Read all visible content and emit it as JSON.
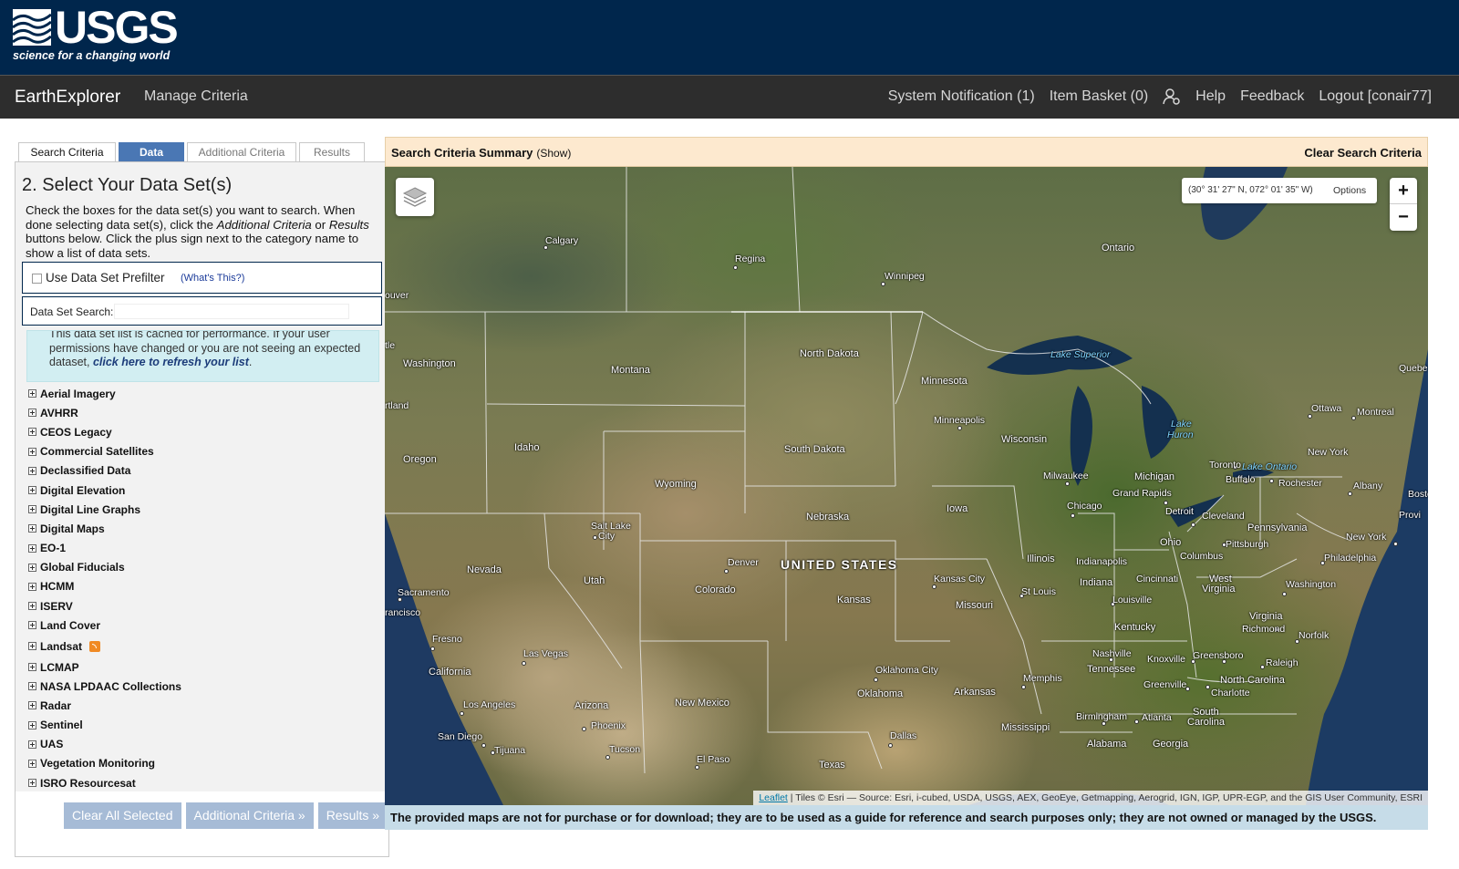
{
  "header": {
    "logo_text": "USGS",
    "logo_tagline": "science for a changing world"
  },
  "nav": {
    "app_title": "EarthExplorer",
    "manage_criteria": "Manage Criteria",
    "system_notification": "System Notification (1)",
    "item_basket": "Item Basket (0)",
    "user_icon": "user-settings-icon",
    "help": "Help",
    "feedback": "Feedback",
    "logout": "Logout [conair77]"
  },
  "tabs": [
    "Search Criteria",
    "Data Sets",
    "Additional Criteria",
    "Results"
  ],
  "active_tab": "Data Sets",
  "left_panel": {
    "title": "2. Select Your Data Set(s)",
    "instructions_1": "Check the boxes for the data set(s) you want to search. When done selecting data set(s), click the ",
    "instructions_addl": "Additional Criteria",
    "instructions_2": " or ",
    "instructions_results": "Results",
    "instructions_3": " buttons below. Click the plus sign next to the category name to show a list of data sets.",
    "prefilter_label": "Use Data Set Prefilter",
    "prefilter_help": "(What's This?)",
    "search_label": "Data Set Search:",
    "search_value": "",
    "notice_1": "This data set list is cached for performance. If your user permissions have changed or you are not seeing an expected dataset, ",
    "notice_link": "click here to refresh your list",
    "notice_2": ".",
    "categories": [
      "Aerial Imagery",
      "AVHRR",
      "CEOS Legacy",
      "Commercial Satellites",
      "Declassified Data",
      "Digital Elevation",
      "Digital Line Graphs",
      "Digital Maps",
      "EO-1",
      "Global Fiducials",
      "HCMM",
      "ISERV",
      "Land Cover",
      "Landsat",
      "LCMAP",
      "NASA LPDAAC Collections",
      "Radar",
      "Sentinel",
      "UAS",
      "Vegetation Monitoring",
      "ISRO Resourcesat"
    ],
    "buttons": {
      "clear": "Clear All Selected",
      "additional": "Additional Criteria »",
      "results": "Results »"
    }
  },
  "summary_bar": {
    "title": "Search Criteria Summary",
    "show": "(Show)",
    "clear": "Clear Search Criteria"
  },
  "map": {
    "coordinates": "(30° 31' 27\" N, 072° 01' 35\" W)",
    "options": "Options",
    "zoom_in": "+",
    "zoom_out": "−",
    "attribution_link": "Leaflet",
    "attribution_text": " | Tiles © Esri — Source: Esri, i-cubed, USDA, USGS, AEX, GeoEye, Getmapping, Aerogrid, IGN, IGP, UPR-EGP, and the GIS User Community, ESRI",
    "labels": {
      "calgary": "Calgary",
      "regina": "Regina",
      "winnipeg": "Winnipeg",
      "ontario": "Ontario",
      "quebec": "Quebe",
      "couver": "ouver",
      "tle": "tle",
      "washington": "Washington",
      "rtland": "rtland",
      "montana": "Montana",
      "north_dakota": "North Dakota",
      "lake_superior": "Lake Superior",
      "minnesota": "Minnesota",
      "ottawa": "Ottawa",
      "montreal": "Montreal",
      "minneapolis": "Minneapolis",
      "wisconsin": "Wisconsin",
      "lake_huron_1": "Lake",
      "lake_huron_2": "Huron",
      "oregon": "Oregon",
      "idaho": "Idaho",
      "south_dakota": "South Dakota",
      "toronto": "Toronto",
      "lake_ontario": "Lake Ontario",
      "new_york": "New York",
      "milwaukee": "Milwaukee",
      "michigan": "Michigan",
      "buffalo": "Buffalo",
      "rochester": "Rochester",
      "albany": "Albany",
      "bosto": "Bosto",
      "wyoming": "Wyoming",
      "grand_rapids": "Grand Rapids",
      "chicago": "Chicago",
      "provi": "Provi",
      "iowa": "Iowa",
      "detroit": "Detroit",
      "cleveland": "Cleveland",
      "nebraska": "Nebraska",
      "salt_lake": "Salt Lake",
      "city": "City",
      "pennsylvania": "Pennsylvania",
      "new_york_2": "New York",
      "ohio": "Ohio",
      "pittsburgh": "Pittsburgh",
      "philadelphia": "Philadelphia",
      "nevada": "Nevada",
      "denver": "Denver",
      "united_states": "UNITED STATES",
      "illinois": "Illinois",
      "indianapolis": "Indianapolis",
      "columbus": "Columbus",
      "kansas_city": "Kansas City",
      "utah": "Utah",
      "cincinnati": "Cincinnati",
      "west": "West",
      "virginia_w": "Virginia",
      "washington_dc": "Washington",
      "indiana": "Indiana",
      "colorado": "Colorado",
      "sacramento": "Sacramento",
      "st_louis": "St Louis",
      "kansas": "Kansas",
      "missouri": "Missouri",
      "louisville": "Louisville",
      "francisco": "rancisco",
      "virginia": "Virginia",
      "richmond": "Richmond",
      "kentucky": "Kentucky",
      "fresno": "Fresno",
      "norfolk": "Norfolk",
      "las_vegas": "Las Vegas",
      "nashville": "Nashville",
      "knoxville": "Knoxville",
      "greensboro": "Greensboro",
      "raleigh": "Raleigh",
      "california": "California",
      "oklahoma_city": "Oklahoma City",
      "tennessee": "Tennessee",
      "memphis": "Memphis",
      "north_carolina": "North Carolina",
      "greenville": "Greenville",
      "oklahoma": "Oklahoma",
      "arkansas": "Arkansas",
      "charlotte": "Charlotte",
      "los_angeles": "Los Angeles",
      "arizona": "Arizona",
      "new_mexico": "New Mexico",
      "birmingham": "Birmingham",
      "atlanta": "Atlanta",
      "south": "South",
      "carolina": "Carolina",
      "phoenix": "Phoenix",
      "mississippi": "Mississippi",
      "san_diego": "San Diego",
      "dallas": "Dallas",
      "alabama": "Alabama",
      "georgia": "Georgia",
      "tijuana": "Tijuana",
      "tucson": "Tucson",
      "el_paso": "El Paso",
      "texas": "Texas"
    }
  },
  "disclaimer": "The provided maps are not for purchase or for download; they are to be used as a guide for reference and search purposes only; they are not owned or managed by the USGS.",
  "colors": {
    "header_bg": "#00264c",
    "navbar_bg": "#2d2d2d",
    "active_tab": "#4a77b4",
    "button": "#a6bbd6",
    "summary_bg": "#fde9cf",
    "disclaimer_bg": "#c6dce8"
  }
}
